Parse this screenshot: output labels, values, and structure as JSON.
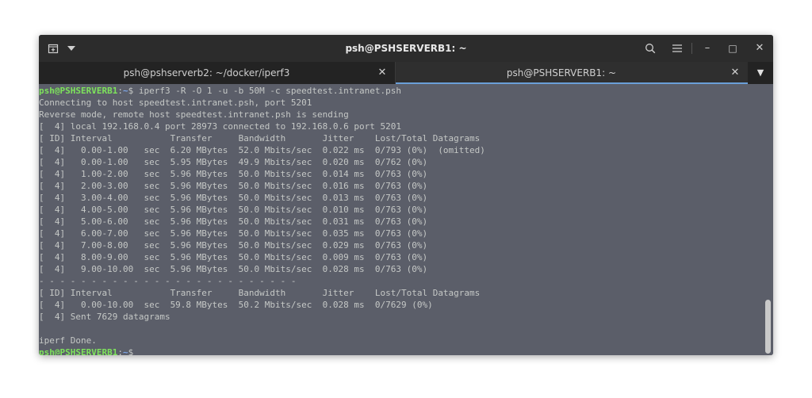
{
  "window": {
    "title": "psh@PSHSERVERB1: ~"
  },
  "titlebar_buttons": {
    "new_tab_icon": "new-tab-icon",
    "menu_icon": "chevron-down-icon",
    "search_icon": "search-icon",
    "hamburger_icon": "hamburger-icon",
    "minimize_label": "–",
    "maximize_label": "□",
    "close_label": "✕"
  },
  "tabs": [
    {
      "label": "psh@pshserverb2: ~/docker/iperf3",
      "close": "✕",
      "active": false
    },
    {
      "label": "psh@PSHSERVERB1: ~",
      "close": "✕",
      "active": true
    }
  ],
  "tab_dropdown": "▼",
  "prompt": {
    "user_host": "psh@PSHSERVERB1",
    "sep": ":",
    "path": "~",
    "symbol": "$ "
  },
  "command": "iperf3 -R -O 1 -u -b 50M -c speedtest.intranet.psh",
  "output_lines": [
    "Connecting to host speedtest.intranet.psh, port 5201",
    "Reverse mode, remote host speedtest.intranet.psh is sending",
    "[  4] local 192.168.0.4 port 28973 connected to 192.168.0.6 port 5201",
    "[ ID] Interval           Transfer     Bandwidth       Jitter    Lost/Total Datagrams",
    "[  4]   0.00-1.00   sec  6.20 MBytes  52.0 Mbits/sec  0.022 ms  0/793 (0%)  (omitted)",
    "[  4]   0.00-1.00   sec  5.95 MBytes  49.9 Mbits/sec  0.020 ms  0/762 (0%)",
    "[  4]   1.00-2.00   sec  5.96 MBytes  50.0 Mbits/sec  0.014 ms  0/763 (0%)",
    "[  4]   2.00-3.00   sec  5.96 MBytes  50.0 Mbits/sec  0.016 ms  0/763 (0%)",
    "[  4]   3.00-4.00   sec  5.96 MBytes  50.0 Mbits/sec  0.013 ms  0/763 (0%)",
    "[  4]   4.00-5.00   sec  5.96 MBytes  50.0 Mbits/sec  0.010 ms  0/763 (0%)",
    "[  4]   5.00-6.00   sec  5.96 MBytes  50.0 Mbits/sec  0.031 ms  0/763 (0%)",
    "[  4]   6.00-7.00   sec  5.96 MBytes  50.0 Mbits/sec  0.035 ms  0/763 (0%)",
    "[  4]   7.00-8.00   sec  5.96 MBytes  50.0 Mbits/sec  0.029 ms  0/763 (0%)",
    "[  4]   8.00-9.00   sec  5.96 MBytes  50.0 Mbits/sec  0.009 ms  0/763 (0%)",
    "[  4]   9.00-10.00  sec  5.96 MBytes  50.0 Mbits/sec  0.028 ms  0/763 (0%)",
    "- - - - - - - - - - - - - - - - - - - - - - - - -",
    "[ ID] Interval           Transfer     Bandwidth       Jitter    Lost/Total Datagrams",
    "[  4]   0.00-10.00  sec  59.8 MBytes  50.2 Mbits/sec  0.028 ms  0/7629 (0%)",
    "[  4] Sent 7629 datagrams",
    "",
    "iperf Done."
  ],
  "colors": {
    "terminal_bg": "#5b5e69",
    "prompt_green": "#7ee35c",
    "path_blue": "#7ea7e8",
    "text": "#c5c8c6"
  }
}
